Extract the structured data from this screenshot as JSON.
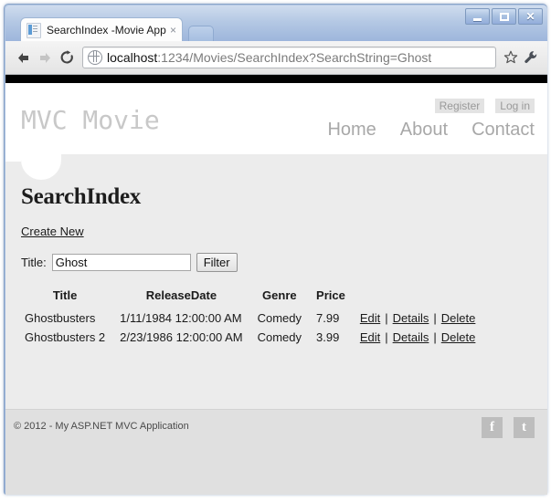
{
  "browser": {
    "tab": {
      "title": "SearchIndex -Movie App",
      "favicon": "document-icon",
      "close": "×"
    },
    "window_controls": {
      "minimize": "minimize-icon",
      "maximize": "maximize-icon",
      "close": "✕"
    },
    "toolbar": {
      "back": "←",
      "forward": "→",
      "reload": "⟳",
      "url_host": "localhost",
      "url_rest": ":1234/Movies/SearchIndex?SearchString=Ghost",
      "url_full": "localhost:1234/Movies/SearchIndex?SearchString=Ghost",
      "bookmark": "☆",
      "menu": "wrench-icon"
    }
  },
  "site": {
    "logo": "MVC Movie",
    "auth": [
      {
        "label": "Register"
      },
      {
        "label": "Log in"
      }
    ],
    "nav": [
      {
        "label": "Home"
      },
      {
        "label": "About"
      },
      {
        "label": "Contact"
      }
    ]
  },
  "main": {
    "heading": "SearchIndex",
    "create_new_label": "Create New",
    "filter": {
      "label": "Title:",
      "value": "Ghost",
      "placeholder": "",
      "button_label": "Filter"
    },
    "table": {
      "headers": [
        "Title",
        "ReleaseDate",
        "Genre",
        "Price"
      ],
      "rows": [
        {
          "title": "Ghostbusters",
          "release_date": "1/11/1984 12:00:00 AM",
          "genre": "Comedy",
          "price": "7.99",
          "actions": {
            "edit": "Edit",
            "details": "Details",
            "delete": "Delete",
            "sep": "|"
          }
        },
        {
          "title": "Ghostbusters 2",
          "release_date": "2/23/1986 12:00:00 AM",
          "genre": "Comedy",
          "price": "3.99",
          "actions": {
            "edit": "Edit",
            "details": "Details",
            "delete": "Delete",
            "sep": "|"
          }
        }
      ]
    }
  },
  "footer": {
    "copyright": "© 2012 - My ASP.NET MVC Application",
    "social": [
      {
        "name": "facebook-icon",
        "glyph": "f"
      },
      {
        "name": "twitter-icon",
        "glyph": "t"
      }
    ]
  },
  "colors": {
    "chrome_frame": "#9ab3d8",
    "page_bg": "#ececec",
    "topbar": "#000000",
    "footer_bg": "#e0e0e0",
    "logo_gray": "#c8c8c8",
    "social_gray": "#bdbdbd"
  }
}
